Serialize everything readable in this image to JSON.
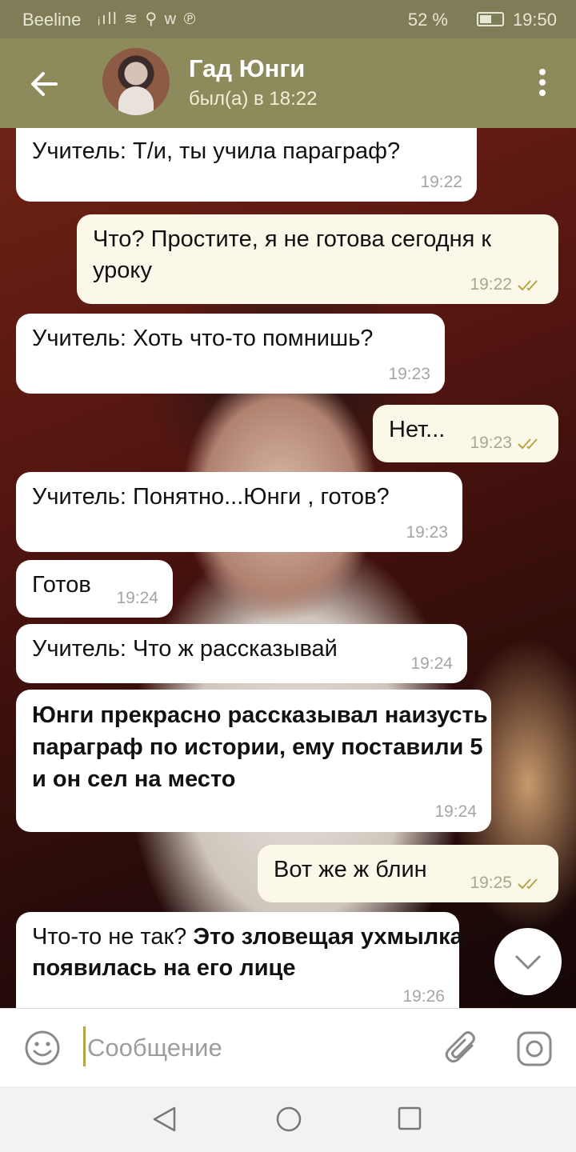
{
  "status_bar": {
    "carrier": "Beeline",
    "icons": "ᵢıll ≋ ⚲ w ℗",
    "battery_text": "52 %",
    "battery_level": 0.52,
    "time": "19:50"
  },
  "header": {
    "title": "Гад Юнги",
    "subtitle": "был(а) в 18:22"
  },
  "messages": [
    {
      "text": "Учитель: Т/и, ты учила параграф?",
      "time": "19:22"
    },
    {
      "text": "Что? Простите, я не готова сегодня к уроку",
      "time": "19:22"
    },
    {
      "text": "Учитель: Хоть что-то помнишь?",
      "time": "19:23"
    },
    {
      "text": "Нет...",
      "time": "19:23"
    },
    {
      "text": "Учитель: Понятно...Юнги , готов?",
      "time": "19:23"
    },
    {
      "text": "Готов",
      "time": "19:24"
    },
    {
      "text": "Учитель: Что ж рассказывай",
      "time": "19:24"
    },
    {
      "text": "Юнги прекрасно рассказывал наизусть параграф по истории, ему поставили 5 и он сел на место",
      "time": "19:24"
    },
    {
      "text": "Вот же ж блин",
      "time": "19:25"
    },
    {
      "text_regular": "Что-то не так?",
      "text_bold": "Это зловещая ухмылка появилась на его лице",
      "time": "19:26"
    }
  ],
  "composer": {
    "placeholder": "Сообщение"
  },
  "colors": {
    "header": "#8d8a5c",
    "status_bar": "#7f7d57",
    "incoming_bubble": "#ffffff",
    "outgoing_bubble": "#fbf8ea",
    "read_ticks": "#b3a546"
  },
  "icons": [
    "back-arrow-icon",
    "more-vertical-icon",
    "double-check-icon",
    "chevron-down-icon",
    "emoji-icon",
    "paperclip-icon",
    "camera-icon",
    "nav-back-icon",
    "nav-home-icon",
    "nav-recent-icon"
  ]
}
